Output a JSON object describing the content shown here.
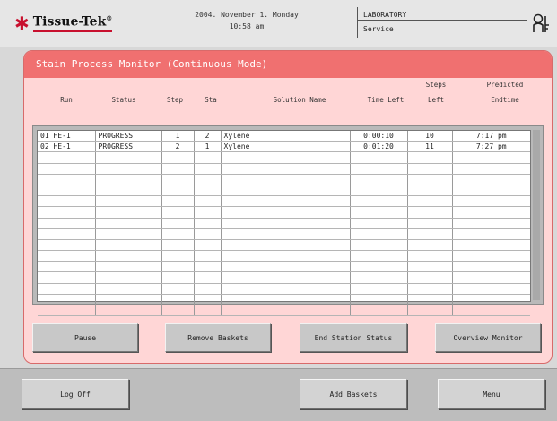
{
  "header": {
    "brand": "Tissue-Tek",
    "brand_mark": "®",
    "date_line": "2004. November 1. Monday",
    "time_line": "10:58 am",
    "mode_label": "LABORATORY",
    "role_label": "Service",
    "user_icon": "key-user-icon"
  },
  "panel": {
    "title": "Stain Process Monitor (Continuous Mode)",
    "columns": {
      "run": "Run",
      "status": "Status",
      "step": "Step",
      "sta": "Sta",
      "solution": "Solution Name",
      "time_left": "Time Left",
      "steps_left_1": "Steps",
      "steps_left_2": "Left",
      "predicted_1": "Predicted",
      "predicted_2": "Endtime"
    },
    "rows": [
      {
        "run": "01 HE-1",
        "status": "PROGRESS",
        "step": "1",
        "sta": "2",
        "solution": "Xylene",
        "time_left": "0:00:10",
        "steps_left": "10",
        "endtime": "7:17 pm"
      },
      {
        "run": "02 HE-1",
        "status": "PROGRESS",
        "step": "2",
        "sta": "1",
        "solution": "Xylene",
        "time_left": "0:01:20",
        "steps_left": "11",
        "endtime": "7:27 pm"
      }
    ]
  },
  "actions": {
    "pause": "Pause",
    "remove_baskets": "Remove Baskets",
    "end_station_status": "End Station Status",
    "overview_monitor": "Overview Monitor"
  },
  "footer": {
    "log_off": "Log Off",
    "add_baskets": "Add Baskets",
    "menu": "Menu"
  },
  "colors": {
    "brand_red": "#c8102e",
    "panel_title_bg": "#f07070",
    "panel_bg": "#ffd6d6"
  }
}
